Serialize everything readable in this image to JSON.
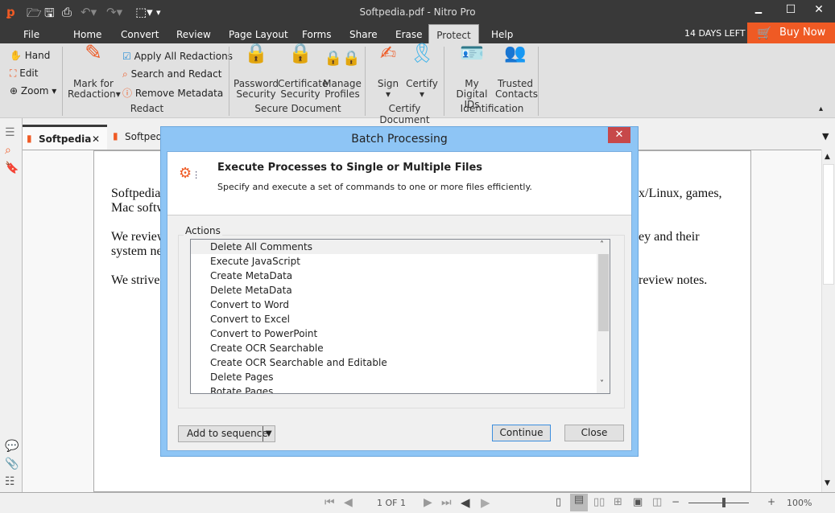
{
  "app": {
    "title": "Softpedia.pdf - Nitro Pro",
    "brand_color": "#ef5a24",
    "icons": [
      "nitro-logo-icon",
      "open-folder-icon",
      "save-icon",
      "print-icon",
      "undo-icon",
      "redo-icon",
      "select-cursor-icon",
      "customize-icon"
    ]
  },
  "window": {
    "minimize": "🗕",
    "maximize": "☐",
    "close": "✕"
  },
  "menu": {
    "file": "File",
    "tabs": [
      "Home",
      "Convert",
      "Review",
      "Page Layout",
      "Forms",
      "Share",
      "Erase",
      "Protect",
      "Help"
    ],
    "active": "Protect",
    "days_left": "14 DAYS LEFT",
    "buy_now": "Buy Now"
  },
  "ribbon": {
    "tools": [
      "Hand",
      "Edit",
      "Zoom"
    ],
    "redact": {
      "mark": [
        "Mark for",
        "Redaction"
      ],
      "apply": "Apply All Redactions",
      "search": "Search and Redact",
      "remove": "Remove Metadata",
      "label": "Redact"
    },
    "secure": {
      "password": [
        "Password",
        "Security"
      ],
      "certificate": [
        "Certificate",
        "Security"
      ],
      "profiles": [
        "Manage",
        "Profiles"
      ],
      "label": "Secure Document"
    },
    "certify": {
      "sign": "Sign",
      "certify": "Certify",
      "label": "Certify Document"
    },
    "ident": {
      "ids": [
        "My Digital",
        "IDs"
      ],
      "contacts": [
        "Trusted",
        "Contacts"
      ],
      "label": "Identification"
    }
  },
  "doc_tabs": [
    {
      "label": "Softpedia",
      "close": "✕"
    },
    {
      "label": "Softped"
    }
  ],
  "document": {
    "left": [
      "Softpedia",
      "Mac softw",
      "We review",
      "system ne",
      "We strive"
    ],
    "right": [
      "x/Linux, games,",
      "ey and their",
      "review notes."
    ]
  },
  "status": {
    "page": "1 OF 1",
    "zoom": "100%",
    "zoom_level": 100,
    "minus": "−",
    "plus": "+"
  },
  "dialog": {
    "title": "Batch Processing",
    "close": "✕",
    "heading": "Execute Processes to Single or Multiple Files",
    "subheading": "Specify and execute a set of commands to one or more files efficiently.",
    "group": "Actions",
    "actions": [
      "Delete All Comments",
      "Execute JavaScript",
      "Create MetaData",
      "Delete MetaData",
      "Convert to Word",
      "Convert to Excel",
      "Convert to PowerPoint",
      "Create OCR Searchable",
      "Create OCR Searchable and Editable",
      "Delete Pages",
      "Rotate Pages"
    ],
    "selected": "Delete All Comments",
    "add": "Add to sequence",
    "continue": "Continue",
    "close_btn": "Close"
  }
}
